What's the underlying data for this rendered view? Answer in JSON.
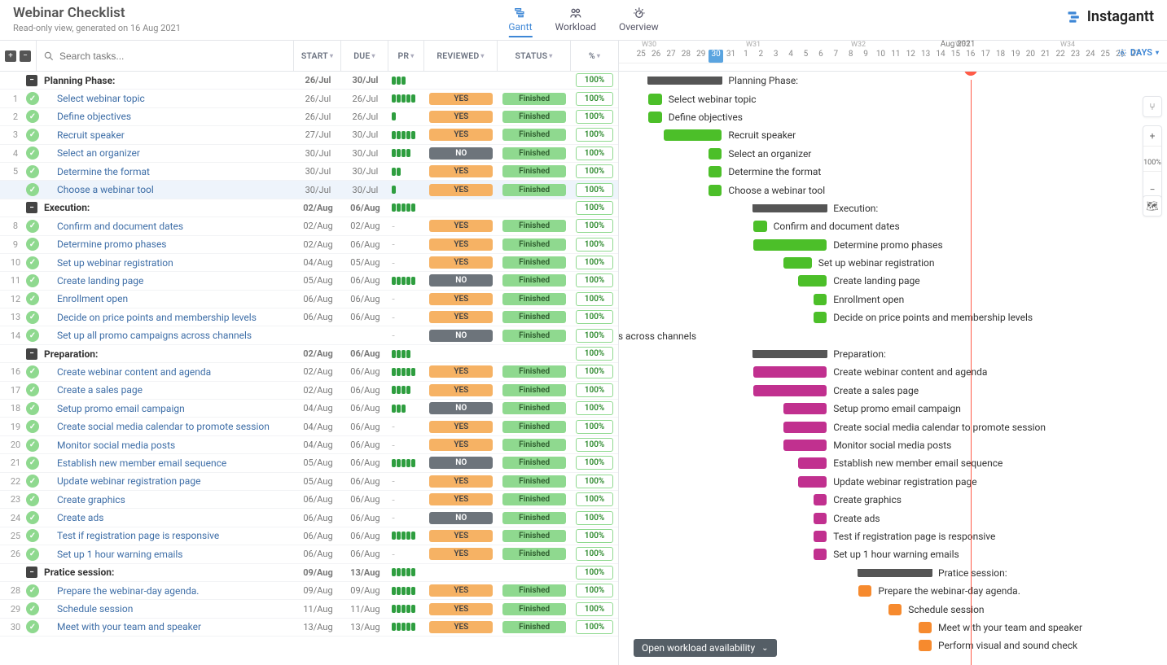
{
  "header": {
    "title": "Webinar Checklist",
    "subtitle": "Read-only view, generated on 16 Aug 2021",
    "tabs": {
      "gantt": "Gantt",
      "workload": "Workload",
      "overview": "Overview"
    },
    "brand": "Instagantt",
    "days_button": "DAYS"
  },
  "search": {
    "placeholder": "Search tasks..."
  },
  "columns": {
    "start": "START",
    "due": "DUE",
    "pr": "PR",
    "reviewed": "REVIEWED",
    "status": "STATUS",
    "pct": "%"
  },
  "timeline": {
    "month_label": "Aug 2021",
    "weeks": [
      "W30",
      "W31",
      "W32",
      "W33",
      "W34"
    ],
    "start_day_index": 0,
    "days": [
      "25",
      "26",
      "27",
      "28",
      "29",
      "30",
      "31",
      "1",
      "2",
      "3",
      "4",
      "5",
      "6",
      "7",
      "8",
      "9",
      "10",
      "11",
      "12",
      "13",
      "14",
      "15",
      "16",
      "17",
      "18",
      "19",
      "20",
      "21",
      "22",
      "23",
      "24",
      "25",
      "26",
      "27"
    ],
    "selected_day_index": 5,
    "today_index": 22,
    "today_label": "16",
    "day_width": 18.4
  },
  "statuses": {
    "yes": "YES",
    "no": "NO",
    "finished": "Finished",
    "pct100": "100%"
  },
  "bottom_button": "Open workload availability",
  "zoom_label_100": "100%",
  "rows": [
    {
      "type": "group",
      "name": "Planning Phase:",
      "start": "26/Jul",
      "due": "30/Jul",
      "pr": 3,
      "pct": "100%",
      "bar_start": 1,
      "bar_len": 5,
      "color": "sum"
    },
    {
      "num": 1,
      "type": "task",
      "name": "Select webinar topic",
      "start": "26/Jul",
      "due": "26/Jul",
      "pr": 5,
      "rev": "YES",
      "stat": "Finished",
      "pct": "100%",
      "bar_start": 1,
      "bar_len": 1,
      "color": "green"
    },
    {
      "num": 2,
      "type": "task",
      "name": "Define objectives",
      "start": "26/Jul",
      "due": "26/Jul",
      "pr": 1,
      "rev": "YES",
      "stat": "Finished",
      "pct": "100%",
      "bar_start": 1,
      "bar_len": 1,
      "color": "green"
    },
    {
      "num": 3,
      "type": "task",
      "name": "Recruit speaker",
      "start": "27/Jul",
      "due": "30/Jul",
      "pr": 5,
      "rev": "YES",
      "stat": "Finished",
      "pct": "100%",
      "bar_start": 2,
      "bar_len": 4,
      "color": "green"
    },
    {
      "num": 4,
      "type": "task",
      "name": "Select an organizer",
      "start": "30/Jul",
      "due": "30/Jul",
      "pr": 4,
      "rev": "NO",
      "stat": "Finished",
      "pct": "100%",
      "bar_start": 5,
      "bar_len": 1,
      "color": "green"
    },
    {
      "num": 5,
      "type": "task",
      "name": "Determine the format",
      "start": "30/Jul",
      "due": "30/Jul",
      "pr": 2,
      "rev": "YES",
      "stat": "Finished",
      "pct": "100%",
      "bar_start": 5,
      "bar_len": 1,
      "color": "green"
    },
    {
      "type": "task",
      "name": "Choose a webinar tool",
      "start": "30/Jul",
      "due": "30/Jul",
      "pr": 1,
      "rev": "YES",
      "stat": "Finished",
      "pct": "100%",
      "bar_start": 5,
      "bar_len": 1,
      "color": "green",
      "hl": true
    },
    {
      "type": "group",
      "name": "Execution:",
      "start": "02/Aug",
      "due": "06/Aug",
      "pr": 5,
      "pct": "100%",
      "bar_start": 8,
      "bar_len": 5,
      "color": "sum"
    },
    {
      "num": 8,
      "type": "task",
      "name": "Confirm and document dates",
      "start": "02/Aug",
      "due": "02/Aug",
      "pr": 0,
      "rev": "YES",
      "stat": "Finished",
      "pct": "100%",
      "bar_start": 8,
      "bar_len": 1,
      "color": "green"
    },
    {
      "num": 9,
      "type": "task",
      "name": "Determine promo phases",
      "start": "02/Aug",
      "due": "06/Aug",
      "pr": 0,
      "rev": "YES",
      "stat": "Finished",
      "pct": "100%",
      "bar_start": 8,
      "bar_len": 5,
      "color": "green"
    },
    {
      "num": 10,
      "type": "task",
      "name": "Set up webinar registration",
      "start": "04/Aug",
      "due": "05/Aug",
      "pr": 0,
      "rev": "YES",
      "stat": "Finished",
      "pct": "100%",
      "bar_start": 10,
      "bar_len": 2,
      "color": "green"
    },
    {
      "num": 11,
      "type": "task",
      "name": "Create landing page",
      "start": "05/Aug",
      "due": "06/Aug",
      "pr": 5,
      "rev": "NO",
      "stat": "Finished",
      "pct": "100%",
      "bar_start": 11,
      "bar_len": 2,
      "color": "green"
    },
    {
      "num": 12,
      "type": "task",
      "name": "Enrollment open",
      "start": "06/Aug",
      "due": "06/Aug",
      "pr": 0,
      "rev": "YES",
      "stat": "Finished",
      "pct": "100%",
      "bar_start": 12,
      "bar_len": 1,
      "color": "green"
    },
    {
      "num": 13,
      "type": "task",
      "name": "Decide on price points and membership levels",
      "start": "06/Aug",
      "due": "06/Aug",
      "pr": 0,
      "rev": "YES",
      "stat": "Finished",
      "pct": "100%",
      "bar_start": 12,
      "bar_len": 1,
      "color": "green"
    },
    {
      "num": 14,
      "type": "task",
      "name": "Set up all promo campaigns across channels",
      "start": "",
      "due": "",
      "pr": 0,
      "rev": "NO",
      "stat": "Finished",
      "pct": "100%",
      "bar_start": -10,
      "bar_len": 0,
      "color": "green"
    },
    {
      "type": "group",
      "name": "Preparation:",
      "start": "02/Aug",
      "due": "06/Aug",
      "pr": 4,
      "pct": "100%",
      "bar_start": 8,
      "bar_len": 5,
      "color": "sum"
    },
    {
      "num": 16,
      "type": "task",
      "name": "Create webinar content and agenda",
      "start": "02/Aug",
      "due": "06/Aug",
      "pr": 5,
      "rev": "YES",
      "stat": "Finished",
      "pct": "100%",
      "bar_start": 8,
      "bar_len": 5,
      "color": "mag"
    },
    {
      "num": 17,
      "type": "task",
      "name": "Create a sales page",
      "start": "02/Aug",
      "due": "06/Aug",
      "pr": 4,
      "rev": "YES",
      "stat": "Finished",
      "pct": "100%",
      "bar_start": 8,
      "bar_len": 5,
      "color": "mag"
    },
    {
      "num": 18,
      "type": "task",
      "name": "Setup promo email campaign",
      "start": "04/Aug",
      "due": "06/Aug",
      "pr": 3,
      "rev": "NO",
      "stat": "Finished",
      "pct": "100%",
      "bar_start": 10,
      "bar_len": 3,
      "color": "mag"
    },
    {
      "num": 19,
      "type": "task",
      "name": "Create social media calendar to promote session",
      "start": "04/Aug",
      "due": "06/Aug",
      "pr": 0,
      "rev": "YES",
      "stat": "Finished",
      "pct": "100%",
      "bar_start": 10,
      "bar_len": 3,
      "color": "mag"
    },
    {
      "num": 20,
      "type": "task",
      "name": "Monitor social media posts",
      "start": "04/Aug",
      "due": "06/Aug",
      "pr": 0,
      "rev": "YES",
      "stat": "Finished",
      "pct": "100%",
      "bar_start": 10,
      "bar_len": 3,
      "color": "mag"
    },
    {
      "num": 21,
      "type": "task",
      "name": "Establish new member email sequence",
      "start": "05/Aug",
      "due": "06/Aug",
      "pr": 5,
      "rev": "NO",
      "stat": "Finished",
      "pct": "100%",
      "bar_start": 11,
      "bar_len": 2,
      "color": "mag"
    },
    {
      "num": 22,
      "type": "task",
      "name": "Update webinar registration page",
      "start": "05/Aug",
      "due": "06/Aug",
      "pr": 0,
      "rev": "YES",
      "stat": "Finished",
      "pct": "100%",
      "bar_start": 11,
      "bar_len": 2,
      "color": "mag"
    },
    {
      "num": 23,
      "type": "task",
      "name": "Create graphics",
      "start": "06/Aug",
      "due": "06/Aug",
      "pr": 0,
      "rev": "YES",
      "stat": "Finished",
      "pct": "100%",
      "bar_start": 12,
      "bar_len": 1,
      "color": "mag"
    },
    {
      "num": 24,
      "type": "task",
      "name": "Create ads",
      "start": "06/Aug",
      "due": "06/Aug",
      "pr": 0,
      "rev": "NO",
      "stat": "Finished",
      "pct": "100%",
      "bar_start": 12,
      "bar_len": 1,
      "color": "mag"
    },
    {
      "num": 25,
      "type": "task",
      "name": "Test if registration page is responsive",
      "start": "06/Aug",
      "due": "06/Aug",
      "pr": 5,
      "rev": "YES",
      "stat": "Finished",
      "pct": "100%",
      "bar_start": 12,
      "bar_len": 1,
      "color": "mag"
    },
    {
      "num": 26,
      "type": "task",
      "name": "Set up 1 hour warning emails",
      "start": "06/Aug",
      "due": "06/Aug",
      "pr": 0,
      "rev": "YES",
      "stat": "Finished",
      "pct": "100%",
      "bar_start": 12,
      "bar_len": 1,
      "color": "mag"
    },
    {
      "type": "group",
      "name": "Pratice session:",
      "start": "09/Aug",
      "due": "13/Aug",
      "pr": 5,
      "pct": "100%",
      "bar_start": 15,
      "bar_len": 5,
      "color": "sum"
    },
    {
      "num": 28,
      "type": "task",
      "name": "Prepare the webinar-day agenda.",
      "start": "09/Aug",
      "due": "09/Aug",
      "pr": 5,
      "rev": "YES",
      "stat": "Finished",
      "pct": "100%",
      "bar_start": 15,
      "bar_len": 1,
      "color": "orange"
    },
    {
      "num": 29,
      "type": "task",
      "name": "Schedule session",
      "start": "11/Aug",
      "due": "11/Aug",
      "pr": 5,
      "rev": "YES",
      "stat": "Finished",
      "pct": "100%",
      "bar_start": 17,
      "bar_len": 1,
      "color": "orange"
    },
    {
      "num": 30,
      "type": "task",
      "name": "Meet with your team and speaker",
      "start": "13/Aug",
      "due": "13/Aug",
      "pr": 5,
      "rev": "YES",
      "stat": "Finished",
      "pct": "100%",
      "bar_start": 19,
      "bar_len": 1,
      "color": "orange"
    },
    {
      "type": "extra",
      "name": "Perform visual and sound check",
      "bar_start": 19,
      "bar_len": 1,
      "color": "orange"
    }
  ]
}
